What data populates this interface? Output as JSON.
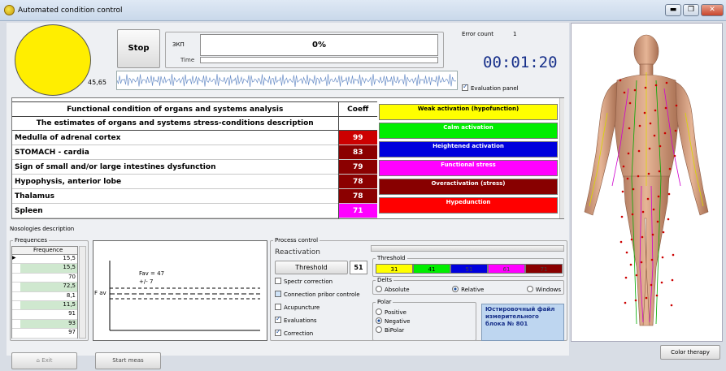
{
  "window": {
    "title": "Automated condition control",
    "minimize": "▬",
    "maximize": "❐",
    "close": "✕"
  },
  "indicator": {
    "value": "45,65",
    "color": "#ffee00"
  },
  "stop_label": "Stop",
  "status": {
    "zkp_label": "ЗКП",
    "progress_text": "0%",
    "time_label": "Time",
    "error_count_label": "Error count",
    "error_count_value": "1",
    "timer": "00:01:20",
    "evaluation_panel_label": "Evaluation panel"
  },
  "organs_table": {
    "header": {
      "title": "Functional condition of organs and systems analysis",
      "coeff": "Coeff"
    },
    "subheader": "The estimates of organs and systems stress-conditions description",
    "rows": [
      {
        "name": "Medulla of adrenal cortex",
        "coeff": "99",
        "color": "#cc0000"
      },
      {
        "name": "STOMACH - cardia",
        "coeff": "83",
        "color": "#8b0000"
      },
      {
        "name": "Sign of small and/or large intestines dysfunction",
        "coeff": "79",
        "color": "#8b0000"
      },
      {
        "name": "Hypophysis, anterior lobe",
        "coeff": "78",
        "color": "#8b0000"
      },
      {
        "name": "Thalamus",
        "coeff": "78",
        "color": "#8b0000"
      },
      {
        "name": "Spleen",
        "coeff": "71",
        "color": "#ff00ff"
      }
    ]
  },
  "legend": [
    {
      "label": "Weak activation (hypofunction)",
      "bg": "#ffff00",
      "fg": "#000000"
    },
    {
      "label": "Calm activation",
      "bg": "#00ee00",
      "fg": "#ffffff"
    },
    {
      "label": "Heightened activation",
      "bg": "#0000dd",
      "fg": "#ffffff"
    },
    {
      "label": "Functional stress",
      "bg": "#ff00ff",
      "fg": "#ffffff"
    },
    {
      "label": "Overactivation (stress)",
      "bg": "#880000",
      "fg": "#ffffff"
    },
    {
      "label": "Hypedunction",
      "bg": "#ff0000",
      "fg": "#ffffff"
    }
  ],
  "nosologies_label": "Nosologies description",
  "frequences": {
    "group_label": "Frequences",
    "column": "Frequence",
    "rows": [
      "15,5",
      "15,5",
      "70",
      "72,5",
      "8,1",
      "11,5",
      "91",
      "93",
      "97"
    ]
  },
  "fav_chart": {
    "fav_text": "Fav = 47",
    "pm_text": "+/-  7",
    "axis_label": "F av"
  },
  "process": {
    "group_label": "Process control",
    "state": "Reactivation",
    "threshold_button": "Threshold",
    "threshold_value": "51",
    "checks": [
      {
        "label": "Spectr correction",
        "checked": false
      },
      {
        "label": "Connection pribor controle",
        "checked": false
      },
      {
        "label": "Acupuncture",
        "checked": false
      },
      {
        "label": "Evaluations",
        "checked": true
      },
      {
        "label": "Correction",
        "checked": true
      }
    ],
    "threshold_group": "Threshold",
    "threshold_cells": [
      {
        "v": "31",
        "bg": "#ffff00"
      },
      {
        "v": "41",
        "bg": "#00ee00"
      },
      {
        "v": "51",
        "bg": "#0000dd"
      },
      {
        "v": "61",
        "bg": "#ff00ff"
      },
      {
        "v": "71",
        "bg": "#880000"
      }
    ],
    "delts_group": "Delts",
    "delts": [
      {
        "label": "Absolute",
        "on": false
      },
      {
        "label": "Relative",
        "on": true
      },
      {
        "label": "Windows",
        "on": false
      }
    ],
    "polar_group": "Polar",
    "polar": [
      {
        "label": "Positive",
        "on": false
      },
      {
        "label": "Negative",
        "on": true
      },
      {
        "label": "BiPolar",
        "on": false
      }
    ],
    "file_note": "Юстировочный файл измерительного блока № 801"
  },
  "bottom": {
    "exit_label": "Exit",
    "start_label": "Start meas",
    "color_therapy_label": "Color therapy"
  }
}
